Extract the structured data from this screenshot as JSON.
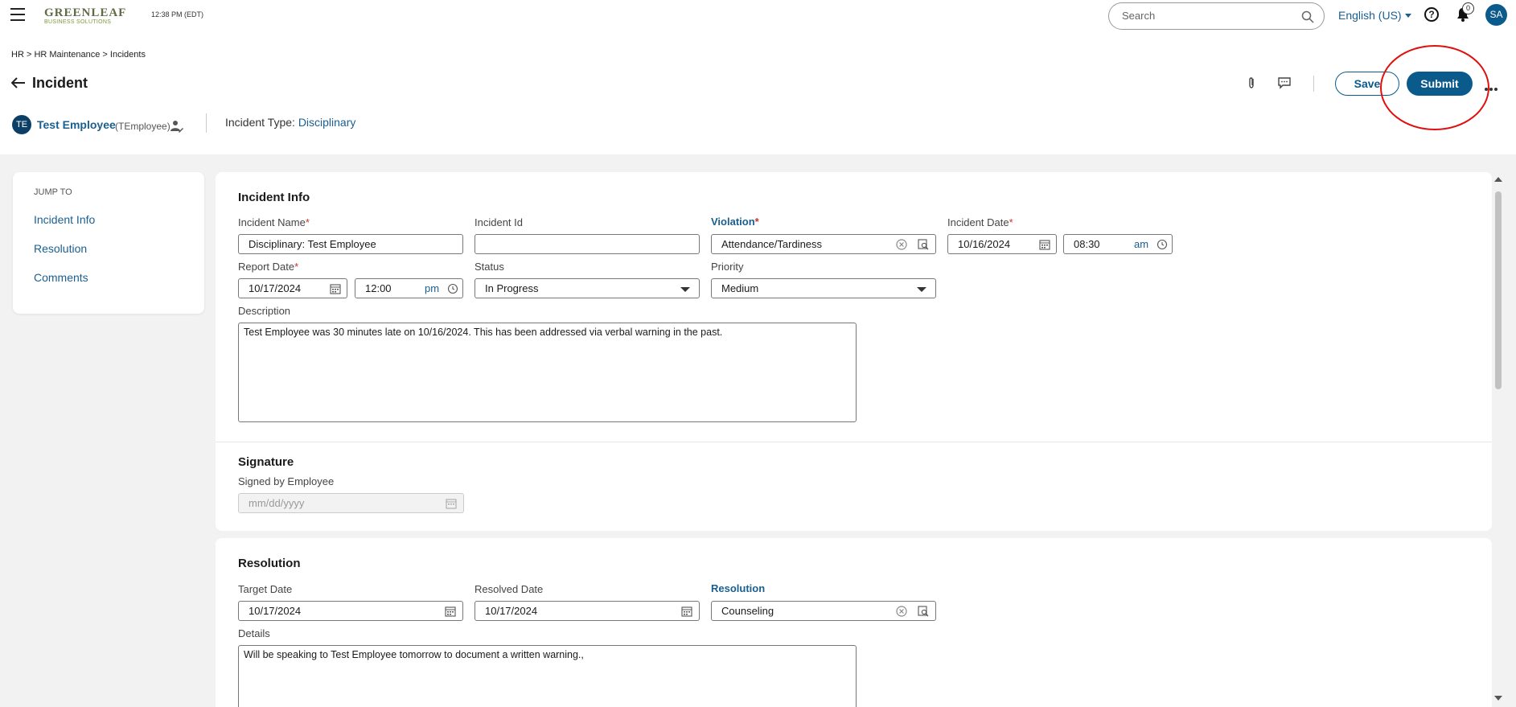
{
  "header": {
    "logo_text": "GREENLEAF",
    "logo_sub": "BUSINESS SOLUTIONS",
    "time": "12:38 PM (EDT)",
    "search_placeholder": "Search",
    "language": "English (US)",
    "help": "?",
    "notification_count": "0",
    "user_initials": "SA"
  },
  "breadcrumb": [
    "HR",
    "HR Maintenance",
    "Incidents"
  ],
  "page": {
    "title": "Incident",
    "save_label": "Save",
    "submit_label": "Submit"
  },
  "employee": {
    "initials": "TE",
    "name": "Test Employee",
    "id": "(TEmployee)",
    "incident_type_label": "Incident Type:",
    "incident_type_value": "Disciplinary"
  },
  "jump": {
    "heading": "JUMP TO",
    "items": [
      "Incident Info",
      "Resolution",
      "Comments"
    ]
  },
  "incident_info": {
    "title": "Incident Info",
    "incident_name_label": "Incident Name",
    "incident_name_value": "Disciplinary: Test Employee",
    "incident_id_label": "Incident Id",
    "incident_id_value": "",
    "violation_label": "Violation",
    "violation_value": "Attendance/Tardiness",
    "incident_date_label": "Incident Date",
    "incident_date_value": "10/16/2024",
    "incident_time_value": "08:30",
    "incident_time_ampm": "am",
    "report_date_label": "Report Date",
    "report_date_value": "10/17/2024",
    "report_time_value": "12:00",
    "report_time_ampm": "pm",
    "status_label": "Status",
    "status_value": "In Progress",
    "priority_label": "Priority",
    "priority_value": "Medium",
    "description_label": "Description",
    "description_value": "Test Employee was 30 minutes late on 10/16/2024.  This has been addressed via verbal warning in the past."
  },
  "signature": {
    "title": "Signature",
    "signed_label": "Signed by Employee",
    "signed_placeholder": "mm/dd/yyyy"
  },
  "resolution": {
    "title": "Resolution",
    "target_date_label": "Target Date",
    "target_date_value": "10/17/2024",
    "resolved_date_label": "Resolved Date",
    "resolved_date_value": "10/17/2024",
    "resolution_label": "Resolution",
    "resolution_value": "Counseling",
    "details_label": "Details",
    "details_value": "Will be speaking to Test Employee tomorrow to document a written warning.,"
  },
  "colors": {
    "primary": "#0b5a8c",
    "link": "#1a5f8f",
    "required": "#c0392b",
    "annotation": "#e01010"
  }
}
